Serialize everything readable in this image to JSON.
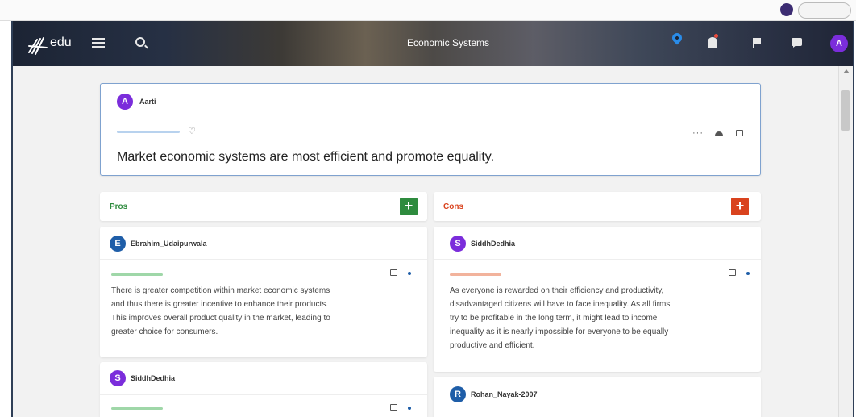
{
  "app": {
    "name": "edu",
    "page_title": "Economic Systems",
    "user_initial": "A"
  },
  "claim": {
    "author": "Aarti",
    "author_initial": "A",
    "text": "Market economic systems are most efficient and promote equality."
  },
  "columns": {
    "pros": {
      "title": "Pros",
      "add_label": "+"
    },
    "cons": {
      "title": "Cons",
      "add_label": "+"
    }
  },
  "pros": [
    {
      "author": "Ebrahim_Udaipurwala",
      "initial": "E",
      "lines": [
        "There is greater competition within market economic systems",
        "and thus there is greater incentive to enhance their products.",
        "This improves overall product quality in the market, leading to",
        "greater choice for consumers."
      ]
    },
    {
      "author": "SiddhDedhia",
      "initial": "S"
    }
  ],
  "cons": [
    {
      "author": "SiddhDedhia",
      "initial": "S",
      "lines": [
        "As everyone is rewarded on their efficiency and productivity,",
        "disadvantaged citizens will have to face inequality. As all firms",
        "try to be profitable in the long term, it might lead to income",
        "inequality as it is nearly impossible for everyone to be equally",
        "productive and efficient."
      ]
    },
    {
      "author": "Rohan_Nayak-2007",
      "initial": "R"
    }
  ],
  "colors": {
    "pro_accent": "#2e8b3e",
    "con_accent": "#d9431e",
    "pro_tag": "#9fd7a8",
    "con_tag": "#f2b39c",
    "neutral_tag": "#b8d2ee",
    "avatar_purple": "#7b2ddb",
    "avatar_blue": "#1f5ea8"
  }
}
